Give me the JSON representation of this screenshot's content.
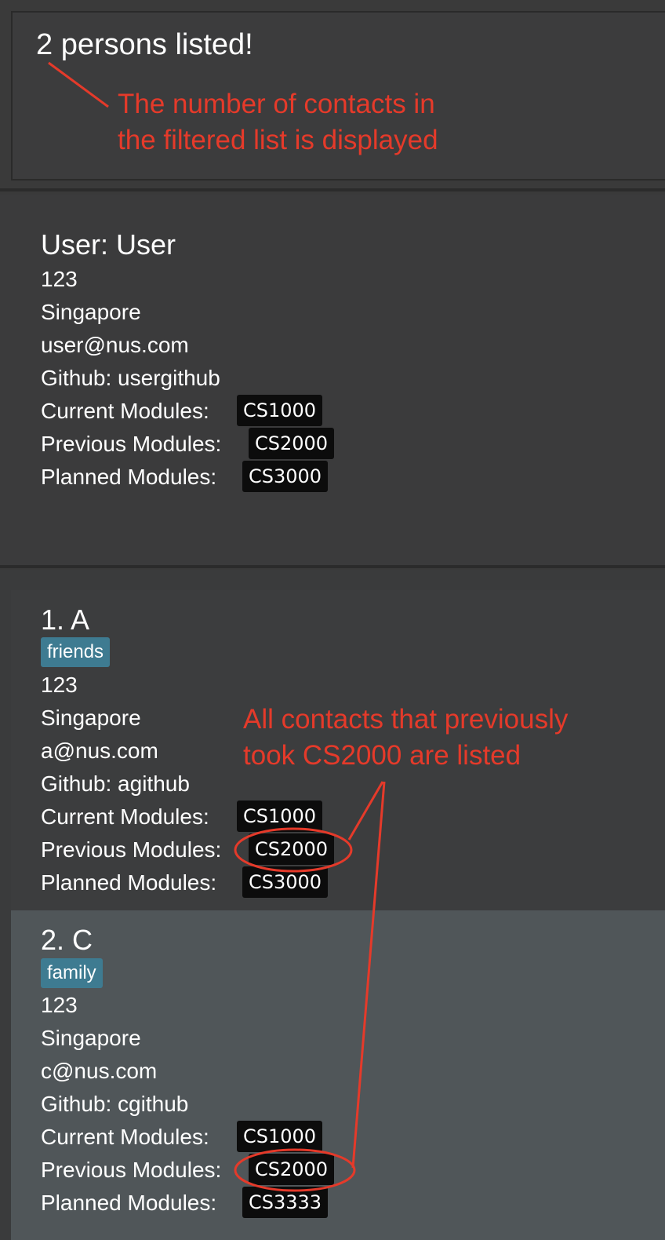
{
  "result": {
    "text": "2 persons listed!"
  },
  "annotations": {
    "count_note_line1": "The number of contacts in",
    "count_note_line2": "the filtered list is displayed",
    "listed_note_line1": "All contacts that previously",
    "listed_note_line2": "took CS2000 are listed",
    "color": "#e53a2a"
  },
  "user": {
    "title": "User:  User",
    "phone": "123",
    "address": "Singapore",
    "email": "user@nus.com",
    "github": "Github: usergithub",
    "current_label": "Current Modules:",
    "current_module": "CS1000",
    "previous_label": "Previous Modules:",
    "previous_module": "CS2000",
    "planned_label": "Planned Modules:",
    "planned_module": "CS3000"
  },
  "persons": [
    {
      "title": "1.  A",
      "tag": "friends",
      "phone": "123",
      "address": "Singapore",
      "email": "a@nus.com",
      "github": "Github: agithub",
      "current_label": "Current Modules:",
      "current_module": "CS1000",
      "previous_label": "Previous Modules:",
      "previous_module": "CS2000",
      "planned_label": "Planned Modules:",
      "planned_module": "CS3000"
    },
    {
      "title": "2.  C",
      "tag": "family",
      "phone": "123",
      "address": "Singapore",
      "email": "c@nus.com",
      "github": "Github: cgithub",
      "current_label": "Current Modules:",
      "current_module": "CS1000",
      "previous_label": "Previous Modules:",
      "previous_module": "CS2000",
      "planned_label": "Planned Modules:",
      "planned_module": "CS3333"
    }
  ]
}
